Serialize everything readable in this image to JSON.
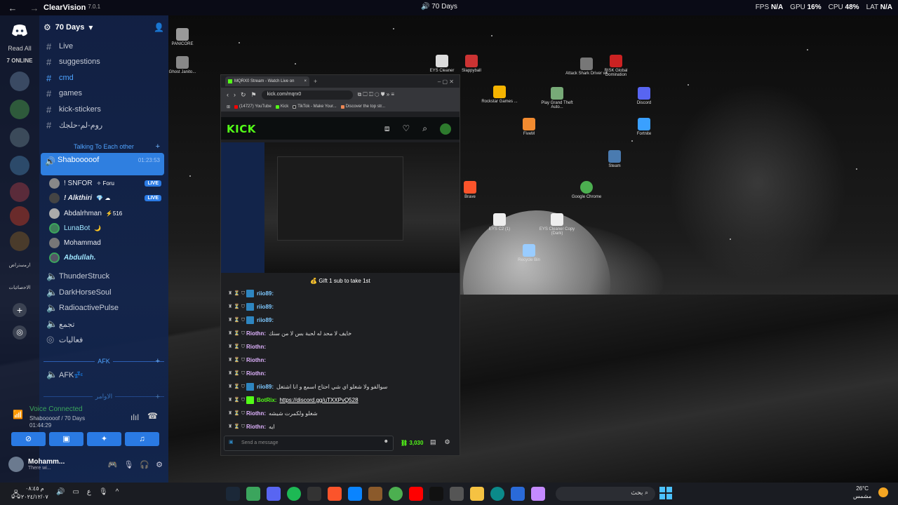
{
  "topbar": {
    "app_name": "ClearVision",
    "version": "7.0.1",
    "channel": "70 Days",
    "fps_label": "FPS",
    "fps_value": "N/A",
    "gpu_label": "GPU",
    "gpu_value": "16%",
    "cpu_label": "CPU",
    "cpu_value": "48%",
    "lat_label": "LAT",
    "lat_value": "N/A"
  },
  "rail": {
    "read_all": "Read All",
    "online": "7 ONLINE",
    "label1": "ﺍﺭﻣﺳﺗﺭﺍﺽ",
    "label2": "ﺍﻻﺣﺻﺎﺋﻳﺎﺕ"
  },
  "server": {
    "name": "70 Days"
  },
  "channels": [
    {
      "name": "Live"
    },
    {
      "name": "suggestions"
    },
    {
      "name": "cmd"
    },
    {
      "name": "games"
    },
    {
      "name": "kick-stickers"
    },
    {
      "name": "روم-لم-حلجك"
    }
  ],
  "category_talk": "Talking To Each other",
  "voice_active": {
    "name": "Shabooooof",
    "time": "01:23:53"
  },
  "voice_users": [
    {
      "name": "! SNFOR",
      "tag": "✧ Foru",
      "live": "LIVE"
    },
    {
      "name": "! Alkthiri",
      "tag": "💎 ☁",
      "live": "LIVE"
    },
    {
      "name": "Abdalrhman",
      "tag": "⚡516",
      "live": ""
    },
    {
      "name": "LunaBot",
      "tag": "🌙",
      "live": ""
    },
    {
      "name": "Mohammad",
      "tag": "",
      "live": ""
    },
    {
      "name": "Abdullah.",
      "tag": "",
      "live": ""
    }
  ],
  "voice_channels": [
    {
      "name": "ThunderStruck"
    },
    {
      "name": "DarkHorseSoul"
    },
    {
      "name": "RadioactivePulse"
    },
    {
      "name": "تجمع"
    },
    {
      "name": "فعاليات"
    }
  ],
  "category_afk": "AFK",
  "afk_channel": "AFK💤",
  "category_other": "الاوامر",
  "voice_connected": {
    "title": "Voice Connected",
    "sub": "Shabooooof / 70 Days",
    "timer": "01:44:29"
  },
  "user": {
    "name": "Mohamm...",
    "status": "There wi..."
  },
  "desktop_icons": [
    {
      "label": "PANICORE",
      "color": "#999"
    },
    {
      "label": "Ghost Janito...",
      "color": "#888"
    },
    {
      "label": "EYS Cleaner",
      "color": "#ddd"
    },
    {
      "label": "Slappyball",
      "color": "#c33"
    },
    {
      "label": "Attack Shark Driver v4",
      "color": "#777"
    },
    {
      "label": "RISK Global Domination",
      "color": "#c22"
    },
    {
      "label": "Rockstar Games ...",
      "color": "#f5b400"
    },
    {
      "label": "Play Grand Theft Auto...",
      "color": "#7a7"
    },
    {
      "label": "Discord",
      "color": "#5865f2"
    },
    {
      "label": "FiveM",
      "color": "#f28b30"
    },
    {
      "label": "Fortnite",
      "color": "#3aa0ff"
    },
    {
      "label": "Steam",
      "color": "#4a7bb0"
    },
    {
      "label": "Brave",
      "color": "#fb542b"
    },
    {
      "label": "Google Chrome",
      "color": "#4caf50"
    },
    {
      "label": "EYS C2 (1)",
      "color": "#eee"
    },
    {
      "label": "EYS Cleaner Copy (Dark)",
      "color": "#eee"
    },
    {
      "label": "Recycle Bin",
      "color": "#9cf"
    }
  ],
  "browser": {
    "tab_title": "MQRX0 Stream - Watch Live on",
    "url": "kick.com/mqrx0",
    "bookmarks": [
      {
        "label": "(14727) YouTube",
        "color": "#f00"
      },
      {
        "label": "Kick",
        "color": "#53fc18"
      },
      {
        "label": "TikTok - Make Your...",
        "color": "#222"
      },
      {
        "label": "Discover the top str...",
        "color": "#e85"
      }
    ],
    "logo": "KICK",
    "pinned": "Gift 1 sub to take 1st",
    "chat": [
      {
        "user": "riio89:",
        "text": "",
        "color": "#7ec8ff"
      },
      {
        "user": "riio89:",
        "text": "",
        "color": "#7ec8ff"
      },
      {
        "user": "riio89:",
        "text": "",
        "color": "#7ec8ff"
      },
      {
        "user": "Riothn:",
        "text": "خايف لا محد له لحبة بس لا من سنك",
        "color": "#e0b3ff"
      },
      {
        "user": "Riothn:",
        "text": "",
        "color": "#e0b3ff"
      },
      {
        "user": "Riothn:",
        "text": "",
        "color": "#e0b3ff"
      },
      {
        "user": "Riothn:",
        "text": "",
        "color": "#e0b3ff"
      },
      {
        "user": "riio89:",
        "text": "سوالفو ولا شغلو اي شي احتاج اسمع و انا اشتغل",
        "color": "#7ec8ff"
      },
      {
        "user": "BotRix:",
        "text": "https://discord.gg/uTXXPvQ528",
        "color": "#53fc18"
      },
      {
        "user": "Riothn:",
        "text": "شغلو ولكمرت شيشه",
        "color": "#e0b3ff"
      },
      {
        "user": "Riothn:",
        "text": "ايه",
        "color": "#e0b3ff"
      }
    ],
    "input_placeholder": "Send a message",
    "coins": "3,030"
  },
  "taskbar": {
    "time": "م ٠٨:٤٥",
    "date": "٢٠٢٤/١٢/٠٧",
    "lang": "ع",
    "search": "بحث",
    "temp": "26°C",
    "weather": "مشمس"
  }
}
